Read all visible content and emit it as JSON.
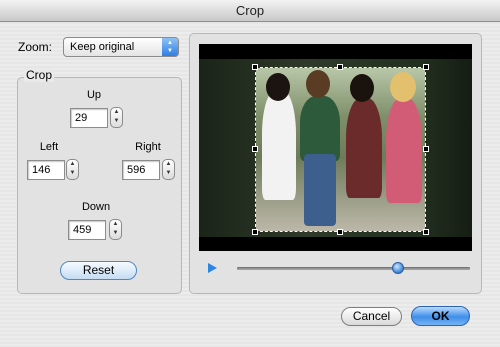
{
  "window": {
    "title": "Crop"
  },
  "zoom": {
    "label": "Zoom:",
    "selected": "Keep original"
  },
  "crop": {
    "group_label": "Crop",
    "up_label": "Up",
    "up_value": "29",
    "left_label": "Left",
    "left_value": "146",
    "right_label": "Right",
    "right_value": "596",
    "down_label": "Down",
    "down_value": "459",
    "reset_label": "Reset"
  },
  "preview": {
    "slider_position": 0.69
  },
  "actions": {
    "cancel_label": "Cancel",
    "ok_label": "OK"
  },
  "icons": {
    "play": "play-icon",
    "popup": "popup-arrows-icon",
    "stepper": "stepper-arrows-icon"
  },
  "colors": {
    "accent": "#3f8fe8",
    "crop_handle": "#a6e3a1"
  }
}
